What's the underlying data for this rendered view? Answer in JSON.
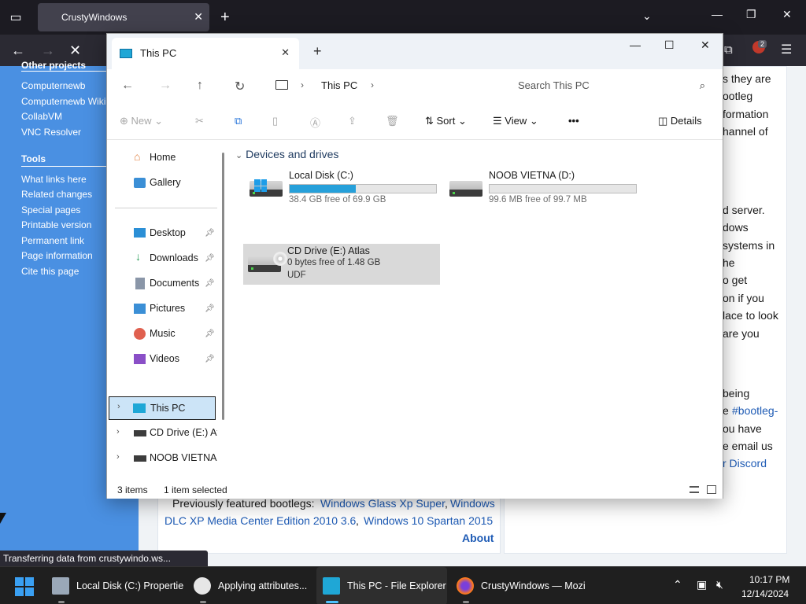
{
  "browser": {
    "tab_title": "CrustyWindows",
    "status_text": "Transferring data from crustywindo.ws..."
  },
  "web": {
    "sidebar_partial_heading": "Other projects",
    "projects": [
      "Computernewb",
      "Computernewb Wiki",
      "CollabVM",
      "VNC Resolver"
    ],
    "tools_heading": "Tools",
    "tools": [
      "What links here",
      "Related changes",
      "Special pages",
      "Printable version",
      "Permanent link",
      "Page information",
      "Cite this page"
    ],
    "right_fragments": [
      "s they are",
      "ootleg",
      "formation",
      "hannel of",
      "d server.",
      "dows",
      "systems in",
      "he",
      "o get",
      "on if you",
      "lace to look",
      "are you",
      "being",
      "e ",
      "#bootleg-",
      "ou have",
      "e email us",
      "r Discord"
    ],
    "featured_prefix": "Previously featured bootlegs: ",
    "featured_link1": "Windows Glass Xp Super",
    "featured_sep": ", ",
    "featured_link2_a": "Windows",
    "featured_link2_b": "DLC XP Media Center Edition 2010 3.6",
    "featured_link3": "Windows 10 Spartan 2015",
    "about_link": "About"
  },
  "explorer": {
    "tab_title": "This PC",
    "breadcrumb": "This PC",
    "search_placeholder": "Search This PC",
    "commands": {
      "new": "New",
      "sort": "Sort",
      "view": "View",
      "more": "•••",
      "details": "Details"
    },
    "nav": {
      "home": "Home",
      "gallery": "Gallery",
      "desktop": "Desktop",
      "downloads": "Downloads",
      "documents": "Documents",
      "pictures": "Pictures",
      "music": "Music",
      "videos": "Videos",
      "this_pc": "This PC",
      "cd_drive": "CD Drive (E:) Atl",
      "noob_vietna": "NOOB VIETNA ("
    },
    "group_header": "Devices and drives",
    "drives": [
      {
        "name": "Local Disk (C:)",
        "free": "38.4 GB free of 69.9 GB",
        "used_fraction": 0.45
      },
      {
        "name": "NOOB VIETNA (D:)",
        "free": "99.6 MB free of 99.7 MB",
        "used_fraction": 0.0
      },
      {
        "name": "CD Drive (E:) Atlas",
        "free": "0 bytes free of 1.48 GB",
        "fs": "UDF"
      }
    ],
    "status": {
      "count": "3 items",
      "selected": "1 item selected"
    }
  },
  "taskbar": {
    "apps": [
      {
        "label": "Local Disk (C:) Propertie"
      },
      {
        "label": "Applying attributes..."
      },
      {
        "label": "This PC - File Explorer"
      },
      {
        "label": "CrustyWindows — Mozi"
      }
    ],
    "time": "10:17 PM",
    "date": "12/14/2024"
  },
  "extension_badge": "2",
  "colors": {
    "web_sidebar": "#4a90e2",
    "link": "#1e5bb5",
    "accent": "#26a0da",
    "selection": "#cce4f7"
  }
}
